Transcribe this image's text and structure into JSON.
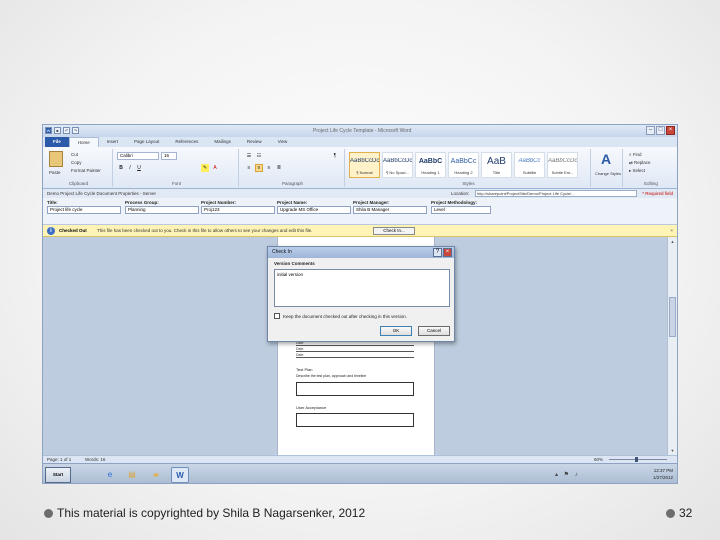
{
  "window": {
    "title": "Project Life Cycle Template - Microsoft Word",
    "qat_undo": "↶",
    "qat_redo": "↷",
    "minimize": "–",
    "maximize": "□",
    "close": "×"
  },
  "ribbon_tabs": [
    "File",
    "Home",
    "Insert",
    "Page Layout",
    "References",
    "Mailings",
    "Review",
    "View"
  ],
  "clipboard": {
    "paste": "Paste",
    "cut": "Cut",
    "copy": "Copy",
    "format_painter": "Format Painter",
    "label": "Clipboard"
  },
  "font": {
    "name": "Calibri",
    "size": "16",
    "bold": "B",
    "italic": "I",
    "underline": "U",
    "label": "Font"
  },
  "paragraph": {
    "label": "Paragraph"
  },
  "styles": {
    "items": [
      {
        "sample": "AaBbCcDc",
        "name": "¶ Normal"
      },
      {
        "sample": "AaBbCcDc",
        "name": "¶ No Spaci..."
      },
      {
        "sample": "AaBbC",
        "name": "Heading 1"
      },
      {
        "sample": "AaBbCc",
        "name": "Heading 2"
      },
      {
        "sample": "AaB",
        "name": "Title"
      },
      {
        "sample": "AaBbCc",
        "name": "Subtitle"
      },
      {
        "sample": "AaBbCcDc",
        "name": "Subtle Em..."
      }
    ],
    "change_styles": "Change Styles",
    "label": "Styles"
  },
  "editing": {
    "find": "Find",
    "replace": "Replace",
    "select": "Select",
    "label": "Editing"
  },
  "doc_props": {
    "header": "Demo Project Life Cycle Document Properties - Server",
    "location_label": "Location:",
    "location_value": "http://sharepoint/ProjectSite/Demo/Project Life Cycle/...",
    "required_note": "* Required field",
    "fields": [
      {
        "label": "Title:",
        "value": "Project life cycle"
      },
      {
        "label": "Process Group:",
        "value": "Planning"
      },
      {
        "label": "Project Number:",
        "value": "Proj123"
      },
      {
        "label": "Project Name:",
        "value": "Upgrade MS Office"
      },
      {
        "label": "Project Manager:",
        "value": "Shila B Manager"
      },
      {
        "label": "Project Methodology:",
        "value": "Level"
      }
    ]
  },
  "checkout": {
    "icon": "i",
    "title": "Checked Out",
    "message": "This file has been checked out to you. Check in this file to allow others to see your changes and edit this file.",
    "button": "Check In...",
    "close": "×"
  },
  "document": {
    "rows": [
      "Date",
      "Date",
      "Date",
      "Date"
    ],
    "label_1": "Test Plan",
    "label_1_sub": "Describe the test plan, approach and timeline",
    "label_2": "User Acceptance"
  },
  "dialog": {
    "title": "Check In",
    "help": "?",
    "close": "×",
    "version_label": "Version Comments",
    "comment": "initial version",
    "keep_checked_out": "Keep the document checked out after checking in this version.",
    "ok": "OK",
    "cancel": "Cancel"
  },
  "statusbar": {
    "page": "Page: 1 of 1",
    "words": "Words: 16",
    "zoom": "60%",
    "zoom_level": 0.45
  },
  "taskbar": {
    "start": "Start",
    "time": "12:37 PM",
    "date": "1/27/2012"
  },
  "footer": {
    "copyright": "This material is copyrighted by Shila B Nagarsenker, 2012",
    "page_number": "32"
  }
}
